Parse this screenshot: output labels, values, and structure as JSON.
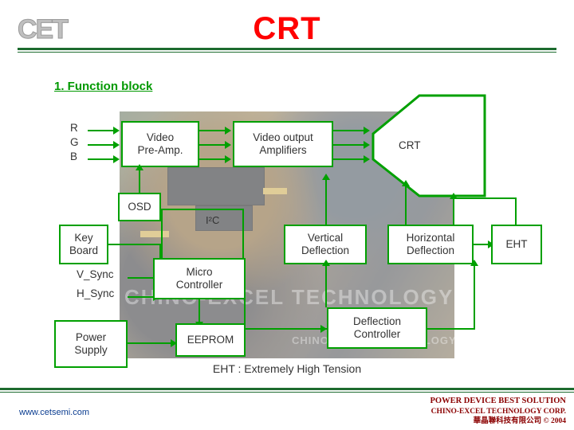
{
  "header": {
    "logo_text": "CET",
    "title": "CRT"
  },
  "section": {
    "heading": "1. Function block"
  },
  "diagram": {
    "inputs": {
      "r": "R",
      "g": "G",
      "b": "B"
    },
    "blocks": [
      {
        "id": "video_preamp",
        "label": "Video\nPre-Amp."
      },
      {
        "id": "video_output_amplifiers",
        "label": "Video output\nAmplifiers"
      },
      {
        "id": "crt",
        "label": "CRT"
      },
      {
        "id": "osd",
        "label": "OSD"
      },
      {
        "id": "key_board",
        "label": "Key\nBoard"
      },
      {
        "id": "micro_controller",
        "label": "Micro\nController"
      },
      {
        "id": "eeprom",
        "label": "EEPROM"
      },
      {
        "id": "power_supply",
        "label": "Power\nSupply"
      },
      {
        "id": "vertical_deflection",
        "label": "Vertical\nDeflection"
      },
      {
        "id": "horizontal_deflection",
        "label": "Horizontal\nDeflection"
      },
      {
        "id": "eht",
        "label": "EHT"
      },
      {
        "id": "deflection_controller",
        "label": "Deflection\nController"
      }
    ],
    "labels": {
      "i2c": "I²C",
      "v_sync": "V_Sync",
      "h_sync": "H_Sync"
    },
    "note": "EHT : Extremely High Tension"
  },
  "watermark": {
    "line1": "CHINO-EXCEL TECHNOLOGY",
    "line2": "CHINO-EXCEL TECHNOLOGY"
  },
  "footer": {
    "url": "www.cetsemi.com",
    "line1": "POWER DEVICE BEST SOLUTION",
    "line2": "CHINO-EXCEL TECHNOLOGY CORP.",
    "line3": "華晶聯科技有限公司 © 2004"
  },
  "colors": {
    "accent_green": "#00a000",
    "title_red": "#ff0000",
    "heading_green": "#009900",
    "rule_green": "#1d6b2f",
    "footer_red": "#8b0000"
  }
}
